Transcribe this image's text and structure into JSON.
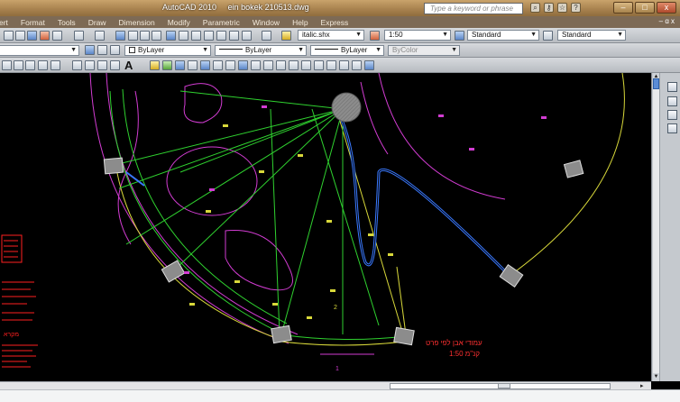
{
  "titlebar": {
    "app": "AutoCAD 2010",
    "file": "ein bokek 210513.dwg",
    "search_placeholder": "Type a keyword or phrase",
    "minimize": "–",
    "restore": "□",
    "close": "x"
  },
  "menu": {
    "items": [
      "ert",
      "Format",
      "Tools",
      "Draw",
      "Dimension",
      "Modify",
      "Parametric",
      "Window",
      "Help",
      "Express"
    ],
    "window_controls": "– ɑ x"
  },
  "toolbar1": {
    "text_style": "italic.shx",
    "dim_scale": "1:50",
    "dim_style": "Standard",
    "table_style": "Standard"
  },
  "toolbar2": {
    "layer_color": "ByLayer",
    "linetype": "ByLayer",
    "lineweight": "ByLayer",
    "plot_style": "ByColor"
  },
  "toolbar3": {
    "text_tool": "A"
  },
  "drawing": {
    "hebrew_note_line1": "עמודי אבן לפי פרט",
    "hebrew_note_line2": "קנ\"מ 1:50",
    "left_note_block": "מקרא",
    "labels": [
      "1",
      "2"
    ]
  },
  "colors": {
    "magenta": "#d23cd2",
    "green": "#2fd12f",
    "yellow": "#d8d83a",
    "blue": "#3a79ff",
    "red": "#ff1f1f",
    "pier_fill": "#8c8c8c"
  }
}
